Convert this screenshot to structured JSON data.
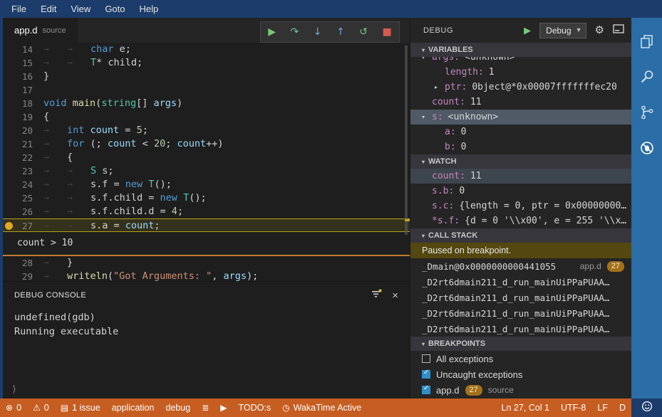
{
  "menubar": {
    "items": [
      "File",
      "Edit",
      "View",
      "Goto",
      "Help"
    ]
  },
  "editor": {
    "tab": {
      "name": "app.d",
      "kind": "source"
    },
    "toolbar": [
      {
        "name": "continue-button",
        "glyph": "▶",
        "color": "#79c97c"
      },
      {
        "name": "step-over-button",
        "glyph": "↷",
        "color": "#6fc3b8"
      },
      {
        "name": "step-into-button",
        "glyph": "↓",
        "color": "#6fa8dc"
      },
      {
        "name": "step-out-button",
        "glyph": "↑",
        "color": "#6fa8dc"
      },
      {
        "name": "restart-button",
        "glyph": "↺",
        "color": "#79c97c"
      },
      {
        "name": "stop-button",
        "glyph": "■",
        "color": "#d65c4a"
      }
    ],
    "code": {
      "current_line": 27,
      "breakpoint_line": 27,
      "peek": {
        "after_line": 27,
        "text": "count > 10"
      },
      "lines": [
        {
          "num": 14,
          "tabs": 2,
          "tokens": [
            [
              "k",
              "char"
            ],
            [
              "p",
              " e;"
            ]
          ]
        },
        {
          "num": 15,
          "tabs": 2,
          "tokens": [
            [
              "t",
              "T"
            ],
            [
              "p",
              "* child;"
            ]
          ]
        },
        {
          "num": 16,
          "tabs": 0,
          "tokens": [
            [
              "p",
              "}"
            ]
          ]
        },
        {
          "num": 17,
          "tabs": 0,
          "tokens": []
        },
        {
          "num": 18,
          "tabs": 0,
          "tokens": [
            [
              "k",
              "void"
            ],
            [
              "p",
              " "
            ],
            [
              "f",
              "main"
            ],
            [
              "p",
              "("
            ],
            [
              "t",
              "string"
            ],
            [
              "p",
              "[] "
            ],
            [
              "v",
              "args"
            ],
            [
              "p",
              ")"
            ]
          ]
        },
        {
          "num": 19,
          "tabs": 0,
          "tokens": [
            [
              "p",
              "{"
            ]
          ]
        },
        {
          "num": 20,
          "tabs": 1,
          "tokens": [
            [
              "k",
              "int"
            ],
            [
              "p",
              " "
            ],
            [
              "v",
              "count"
            ],
            [
              "p",
              " = "
            ],
            [
              "n",
              "5"
            ],
            [
              "p",
              ";"
            ]
          ]
        },
        {
          "num": 21,
          "tabs": 1,
          "tokens": [
            [
              "k",
              "for"
            ],
            [
              "p",
              " (; "
            ],
            [
              "v",
              "count"
            ],
            [
              "p",
              " < "
            ],
            [
              "n",
              "20"
            ],
            [
              "p",
              "; "
            ],
            [
              "v",
              "count"
            ],
            [
              "p",
              "++)"
            ]
          ]
        },
        {
          "num": 22,
          "tabs": 1,
          "tokens": [
            [
              "p",
              "{"
            ]
          ]
        },
        {
          "num": 23,
          "tabs": 2,
          "tokens": [
            [
              "t",
              "S"
            ],
            [
              "p",
              " s;"
            ]
          ]
        },
        {
          "num": 24,
          "tabs": 2,
          "tokens": [
            [
              "p",
              "s.f = "
            ],
            [
              "k",
              "new"
            ],
            [
              "p",
              " "
            ],
            [
              "t",
              "T"
            ],
            [
              "p",
              "();"
            ]
          ]
        },
        {
          "num": 25,
          "tabs": 2,
          "tokens": [
            [
              "p",
              "s.f.child = "
            ],
            [
              "k",
              "new"
            ],
            [
              "p",
              " "
            ],
            [
              "t",
              "T"
            ],
            [
              "p",
              "();"
            ]
          ]
        },
        {
          "num": 26,
          "tabs": 2,
          "tokens": [
            [
              "p",
              "s.f.child.d = "
            ],
            [
              "n",
              "4"
            ],
            [
              "p",
              ";"
            ]
          ]
        },
        {
          "num": 27,
          "tabs": 2,
          "tokens": [
            [
              "p",
              "s.a = "
            ],
            [
              "v",
              "count"
            ],
            [
              "p",
              ";"
            ]
          ]
        },
        {
          "num": 28,
          "tabs": 1,
          "tokens": [
            [
              "p",
              "}"
            ]
          ]
        },
        {
          "num": 29,
          "tabs": 1,
          "tokens": [
            [
              "f",
              "writeln"
            ],
            [
              "p",
              "("
            ],
            [
              "s",
              "\"Got Arguments: \""
            ],
            [
              "p",
              ", "
            ],
            [
              "v",
              "args"
            ],
            [
              "p",
              ");"
            ]
          ]
        }
      ]
    }
  },
  "debug_console": {
    "title": "DEBUG CONSOLE",
    "lines": [
      "undefined(gdb)",
      "Running executable"
    ],
    "prompt": "⟩"
  },
  "debug_panel": {
    "title": "DEBUG",
    "config_selected": "Debug",
    "variables": {
      "title": "VARIABLES",
      "rows": [
        {
          "indent": 1,
          "arrow": "▾",
          "name": "args:",
          "value": "<unknown>",
          "clipped": true
        },
        {
          "indent": 2,
          "name": "length:",
          "value": "1"
        },
        {
          "indent": 2,
          "arrow": "▸",
          "name": "ptr:",
          "value": "0bject@*0x00007fffffffec20"
        },
        {
          "indent": 1,
          "name": "count:",
          "value": "11"
        },
        {
          "indent": 1,
          "arrow": "▾",
          "name": "s:",
          "value": "<unknown>",
          "selected": true
        },
        {
          "indent": 2,
          "name": "a:",
          "value": "0"
        },
        {
          "indent": 2,
          "name": "b:",
          "value": "0"
        }
      ]
    },
    "watch": {
      "title": "WATCH",
      "rows": [
        {
          "name": "count:",
          "value": "11",
          "selected": true
        },
        {
          "name": "s.b:",
          "value": "0"
        },
        {
          "name": "s.c:",
          "value": "{length = 0, ptr = 0x00000000…"
        },
        {
          "name": "*s.f:",
          "value": "{d = 0 '\\\\x00', e = 255 '\\\\x…"
        }
      ]
    },
    "call_stack": {
      "title": "CALL STACK",
      "message": "Paused on breakpoint.",
      "frames": [
        {
          "name": "_Dmain@0x0000000000441055",
          "file": "app.d",
          "line": "27"
        },
        {
          "name": "_D2rt6dmain211_d_run_mainUiPPaPUAA…"
        },
        {
          "name": "_D2rt6dmain211_d_run_mainUiPPaPUAA…"
        },
        {
          "name": "_D2rt6dmain211_d_run_mainUiPPaPUAA…"
        },
        {
          "name": "_D2rt6dmain211_d_run_mainUiPPaPUAA…"
        }
      ]
    },
    "breakpoints": {
      "title": "BREAKPOINTS",
      "items": [
        {
          "checked": false,
          "label": "All exceptions"
        },
        {
          "checked": true,
          "label": "Uncaught exceptions"
        },
        {
          "checked": true,
          "label": "app.d",
          "line": "27",
          "suffix": "source"
        }
      ]
    }
  },
  "activity_bar": {
    "icons": [
      "files",
      "search",
      "source-control",
      "debug-disabled"
    ]
  },
  "status_bar": {
    "left": [
      {
        "icon": "error",
        "text": "0"
      },
      {
        "icon": "warning",
        "text": "0"
      },
      {
        "icon": "issues",
        "text": "1 issue"
      },
      {
        "text": "application"
      },
      {
        "text": "debug"
      },
      {
        "icon": "output"
      },
      {
        "icon": "run"
      },
      {
        "text": "TODO:s"
      },
      {
        "icon": "clock",
        "text": "WakaTime Active"
      }
    ],
    "right": [
      {
        "name": "cursor-position",
        "text": "Ln 27, Col 1"
      },
      {
        "name": "encoding",
        "text": "UTF-8"
      },
      {
        "name": "eol",
        "text": "LF"
      },
      {
        "name": "language-mode",
        "text": "D"
      }
    ]
  },
  "colors": {
    "titlebar": "#1c3d6b",
    "statusbar": "#c65d21",
    "activitybar": "#2b6da6",
    "breakpoint": "#e0a91f",
    "current_line_border": "#b3a117",
    "paused_message_bg": "#54470f",
    "line_badge": "#a2711a",
    "checkbox_checked": "#2f90c9"
  }
}
